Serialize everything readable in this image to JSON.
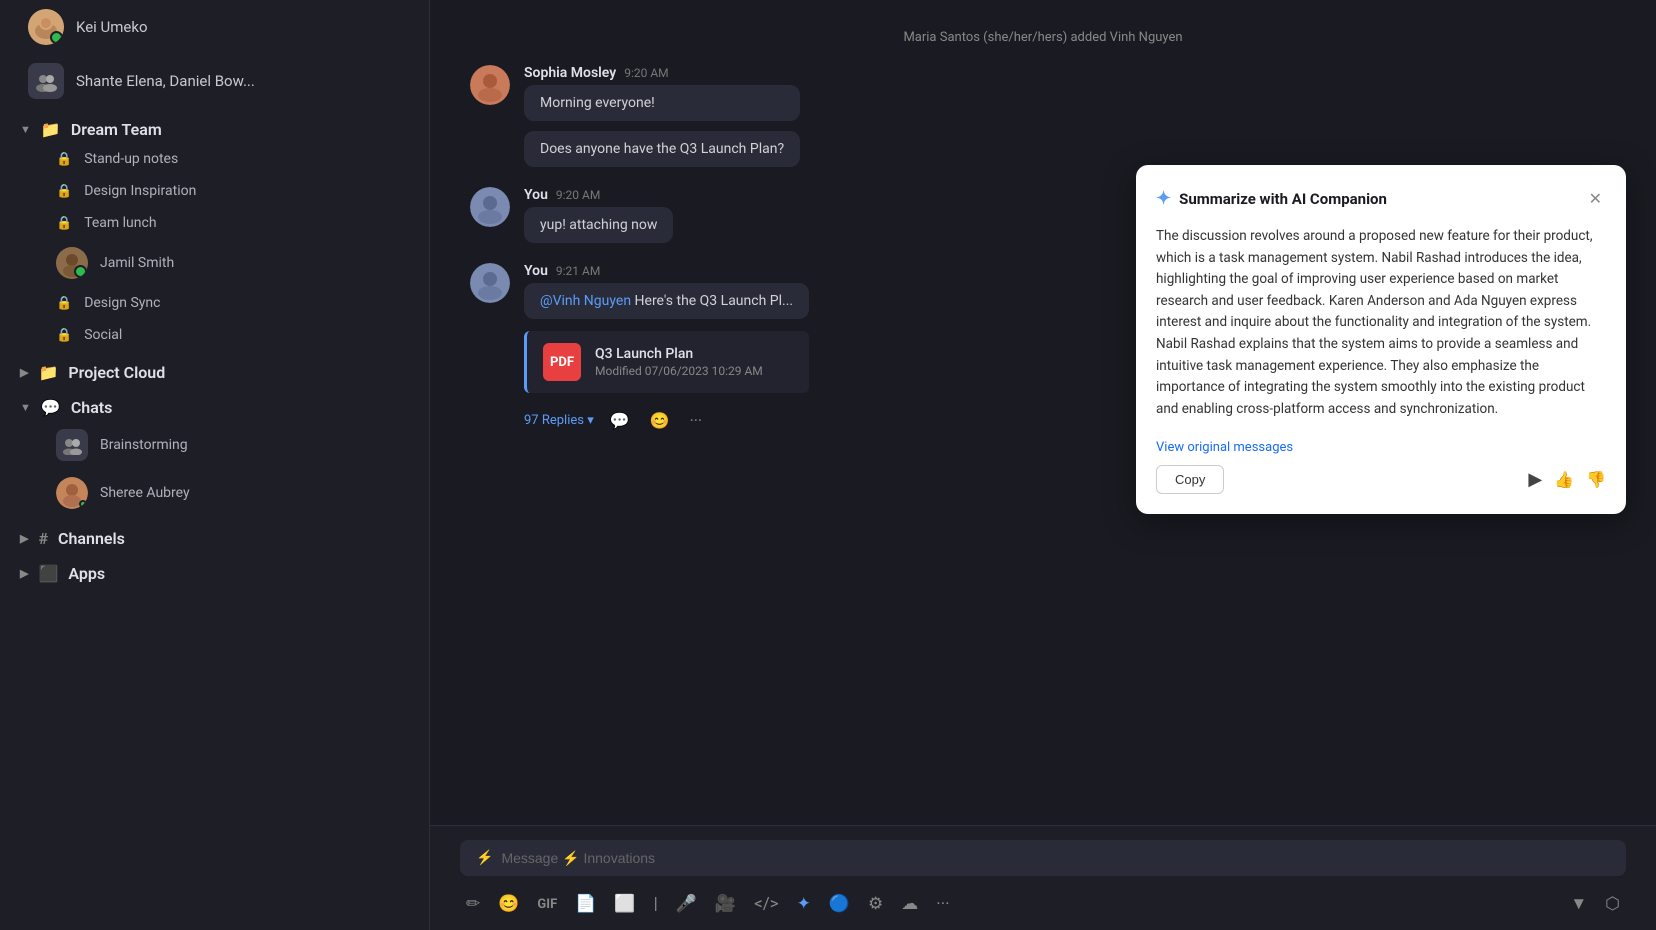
{
  "sidebar": {
    "users": [
      {
        "name": "Kei Umeko",
        "online": true,
        "face": "kei"
      },
      {
        "name": "Shante Elena, Daniel Bow...",
        "face": "group"
      }
    ],
    "dreamTeam": {
      "label": "Dream Team",
      "items": [
        {
          "label": "Stand-up notes",
          "locked": true
        },
        {
          "label": "Design Inspiration",
          "locked": true
        },
        {
          "label": "Team lunch",
          "locked": true
        },
        {
          "name": "Jamil Smith",
          "face": "jamil",
          "online": true
        },
        {
          "label": "Design Sync",
          "locked": true
        },
        {
          "label": "Social",
          "locked": true
        }
      ]
    },
    "projectCloud": {
      "label": "Project Cloud",
      "collapsed": true
    },
    "chats": {
      "label": "Chats",
      "items": [
        {
          "label": "Brainstorming",
          "face": "group"
        },
        {
          "name": "Sheree Aubrey",
          "face": "sheree",
          "online": true
        }
      ]
    },
    "channels": {
      "label": "Channels",
      "collapsed": true
    },
    "apps": {
      "label": "Apps",
      "collapsed": true
    }
  },
  "chat": {
    "systemMessage": "Maria Santos (she/her/hers) added Vinh Nguyen",
    "messages": [
      {
        "id": "msg1",
        "author": "Sophia Mosley",
        "time": "9:20 AM",
        "text": "Morning everyone!",
        "face": "sophia",
        "own": false
      },
      {
        "id": "msg2",
        "author": "",
        "time": "",
        "text": "Does anyone have the Q3 Launch Plan?",
        "face": "",
        "own": false,
        "standalone": true
      },
      {
        "id": "msg3",
        "author": "You",
        "time": "9:20 AM",
        "text": "yup! attaching now",
        "face": "you",
        "own": true
      },
      {
        "id": "msg4",
        "author": "You",
        "time": "9:21 AM",
        "text": "@Vinh Nguyen Here's the Q3 Launch Pl...",
        "mention": "@Vinh Nguyen",
        "face": "you",
        "own": true,
        "hasFile": true,
        "file": {
          "name": "Q3 Launch Plan",
          "meta": "Modified 07/06/2023 10:29 AM"
        },
        "replies": "97 Replies"
      }
    ],
    "inputPlaceholder": "Message",
    "inputChannel": "⚡ Innovations"
  },
  "aiPanel": {
    "title": "Summarize with AI Companion",
    "body": "The discussion revolves around a proposed new feature for their product, which is a task management system. Nabil Rashad introduces the idea, highlighting the goal of improving user experience based on market research and user feedback. Karen Anderson and Ada Nguyen express interest and inquire about the functionality and integration of the system. Nabil Rashad explains that the system aims to provide a seamless and intuitive task management experience. They also emphasize the importance of integrating the system smoothly into the existing product and enabling cross-platform access and synchronization.",
    "viewOriginalLink": "View original messages",
    "copyButton": "Copy"
  }
}
